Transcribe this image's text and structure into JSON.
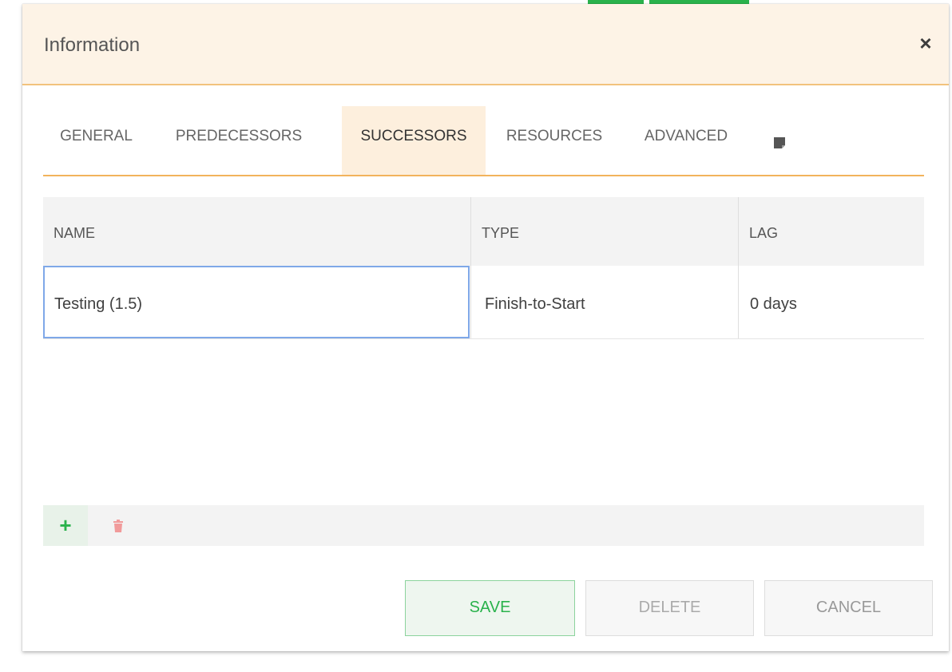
{
  "dialog": {
    "title": "Information",
    "close_glyph": "×"
  },
  "tabs": [
    {
      "label": "GENERAL",
      "active": false
    },
    {
      "label": "PREDECESSORS",
      "active": false
    },
    {
      "label": "SUCCESSORS",
      "active": true
    },
    {
      "label": "RESOURCES",
      "active": false
    },
    {
      "label": "ADVANCED",
      "active": false
    }
  ],
  "tab_icons": {
    "notes": "note-icon"
  },
  "grid": {
    "columns": [
      "NAME",
      "TYPE",
      "LAG"
    ],
    "rows": [
      {
        "name": "Testing (1.5)",
        "type": "Finish-to-Start",
        "lag": "0 days"
      }
    ]
  },
  "toolbar": {
    "add_glyph": "+",
    "add_icon": "plus-icon",
    "delete_icon": "trash-icon"
  },
  "buttons": {
    "save": "SAVE",
    "delete": "DELETE",
    "cancel": "CANCEL"
  },
  "colors": {
    "accent_green": "#2ab24c",
    "header_bg": "#fdf3e6",
    "tab_underline": "#f2b35c",
    "focus_border": "#7fa8e8",
    "trash_red": "#f19a9a"
  }
}
